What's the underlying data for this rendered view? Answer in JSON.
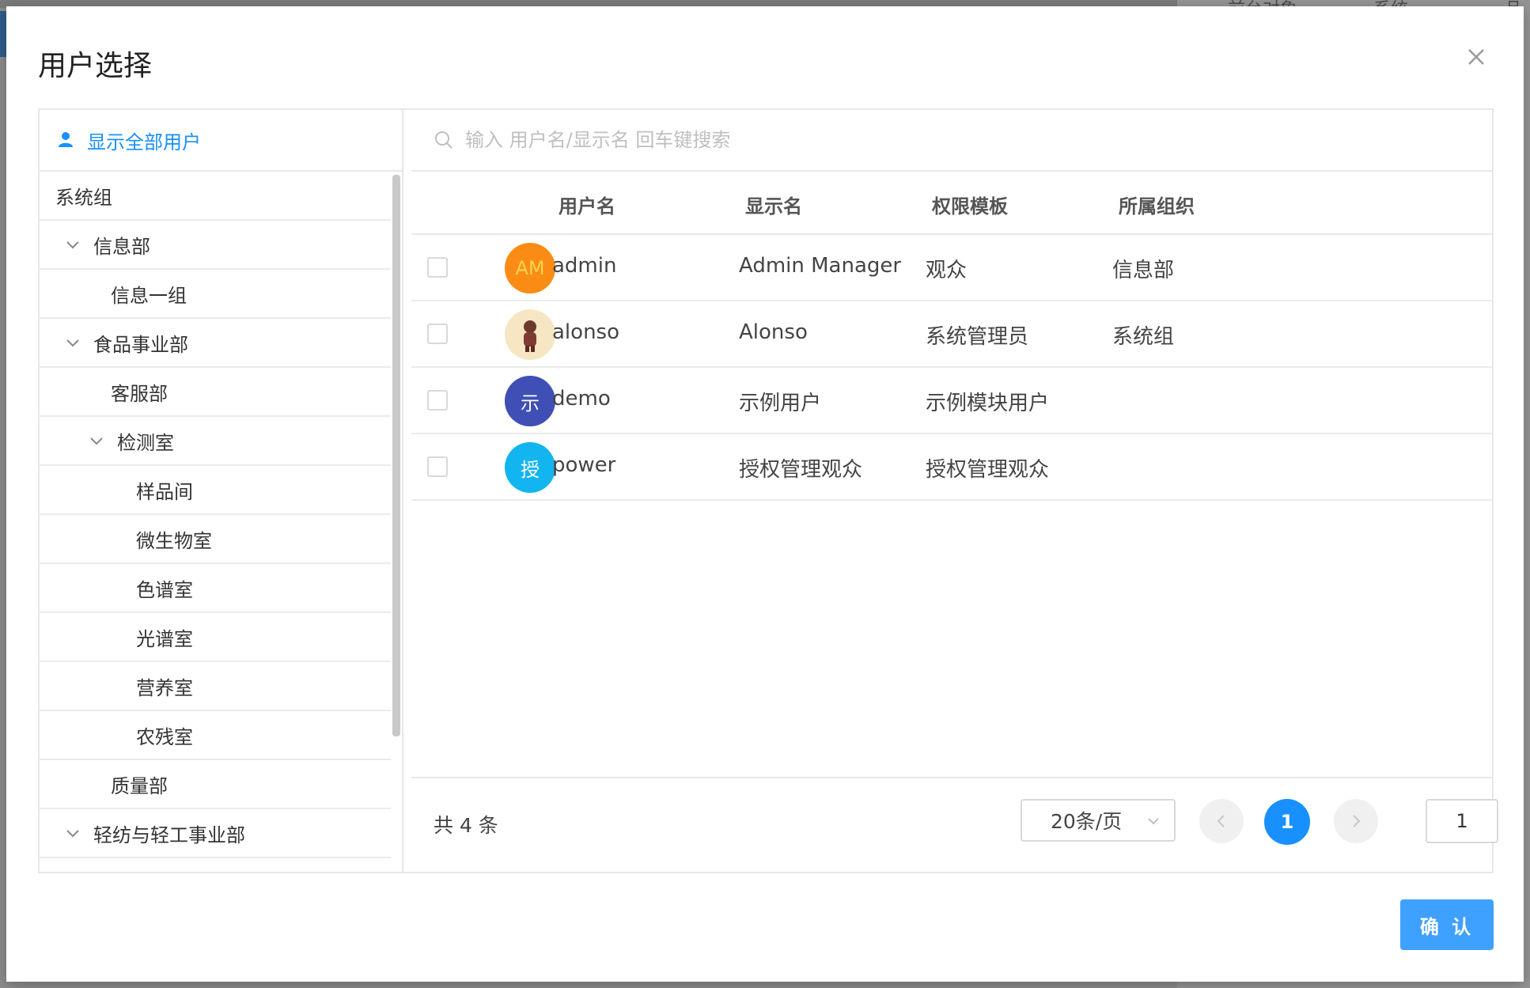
{
  "background": {
    "text_right_1": "前台对象",
    "text_right_2": "系统",
    "text_right_3": "品"
  },
  "dialog": {
    "title": "用户选择",
    "show_all_users": "显示全部用户",
    "search_placeholder": "输入 用户名/显示名 回车键搜索",
    "confirm_label": "确 认"
  },
  "tree": [
    {
      "label": "系统组",
      "level": 0,
      "expanded": null
    },
    {
      "label": "信息部",
      "level": 1,
      "expanded": true
    },
    {
      "label": "信息一组",
      "level": 2,
      "expanded": null
    },
    {
      "label": "食品事业部",
      "level": 1,
      "expanded": true
    },
    {
      "label": "客服部",
      "level": 2,
      "expanded": null
    },
    {
      "label": "检测室",
      "level": 2,
      "expanded": true
    },
    {
      "label": "样品间",
      "level": 3,
      "expanded": null
    },
    {
      "label": "微生物室",
      "level": 3,
      "expanded": null
    },
    {
      "label": "色谱室",
      "level": 3,
      "expanded": null
    },
    {
      "label": "光谱室",
      "level": 3,
      "expanded": null
    },
    {
      "label": "营养室",
      "level": 3,
      "expanded": null
    },
    {
      "label": "农残室",
      "level": 3,
      "expanded": null
    },
    {
      "label": "质量部",
      "level": 2,
      "expanded": null
    },
    {
      "label": "轻纺与轻工事业部",
      "level": 1,
      "expanded": true
    }
  ],
  "table": {
    "columns": [
      "用户名",
      "显示名",
      "权限模板",
      "所属组织"
    ],
    "rows": [
      {
        "avatar_text": "AM",
        "avatar_color": "#fa8c16",
        "avatar_text_color": "#ffd54f",
        "username": "admin",
        "display_name": "Admin Manager",
        "template": "观众",
        "org": "信息部"
      },
      {
        "avatar_text": "",
        "avatar_color": "#f7e6c4",
        "avatar_icon": "character-image-icon",
        "username": "alonso",
        "display_name": "Alonso",
        "template": "系统管理员",
        "org": "系统组"
      },
      {
        "avatar_text": "示",
        "avatar_color": "#3f4fb5",
        "avatar_text_color": "#ffffff",
        "username": "demo",
        "display_name": "示例用户",
        "template": "示例模块用户",
        "org": ""
      },
      {
        "avatar_text": "授",
        "avatar_color": "#13b5f0",
        "avatar_text_color": "#ffffff",
        "username": "power",
        "display_name": "授权管理观众",
        "template": "授权管理观众",
        "org": ""
      }
    ]
  },
  "pagination": {
    "total_text": "共 4 条",
    "page_size": "20条/页",
    "current_page": "1",
    "jump_value": "1"
  },
  "colors": {
    "accent": "#1890ff",
    "confirm": "#3ea0ff"
  }
}
